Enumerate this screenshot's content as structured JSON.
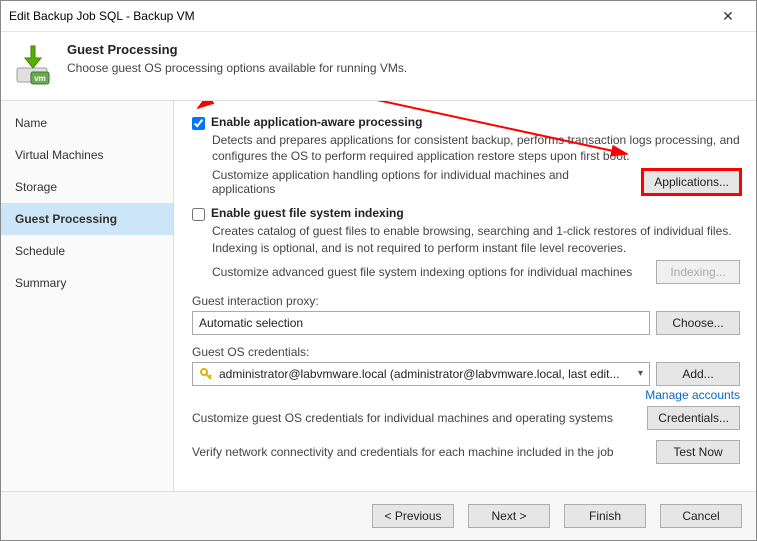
{
  "window": {
    "title": "Edit Backup Job SQL - Backup VM"
  },
  "header": {
    "icon_name": "guest-processing-icon",
    "title": "Guest Processing",
    "subtitle": "Choose guest OS processing options available for running VMs."
  },
  "sidebar": {
    "items": [
      "Name",
      "Virtual Machines",
      "Storage",
      "Guest Processing",
      "Schedule",
      "Summary"
    ],
    "selected_index": 3
  },
  "content": {
    "app_aware": {
      "checked": true,
      "title": "Enable application-aware processing",
      "desc": "Detects and prepares applications for consistent backup, performs transaction logs processing, and configures the OS to perform required application restore steps upon first boot.",
      "customize_label": "Customize application handling options for individual machines and applications",
      "button": "Applications...",
      "button_highlight": true
    },
    "indexing": {
      "checked": false,
      "title": "Enable guest file system indexing",
      "desc": "Creates catalog of guest files to enable browsing, searching and 1-click restores of individual files. Indexing is optional, and is not required to perform instant file level recoveries.",
      "customize_label": "Customize advanced guest file system indexing options for individual machines",
      "button": "Indexing...",
      "button_disabled": true
    },
    "proxy": {
      "label": "Guest interaction proxy:",
      "value": "Automatic selection",
      "button": "Choose..."
    },
    "creds": {
      "label": "Guest OS credentials:",
      "value": "administrator@labvmware.local (administrator@labvmware.local, last edit...",
      "button": "Add...",
      "manage_link": "Manage accounts"
    },
    "creds_customize": {
      "label": "Customize guest OS credentials for individual machines and operating systems",
      "button": "Credentials..."
    },
    "verify": {
      "label": "Verify network connectivity and credentials for each machine included in the job",
      "button": "Test Now"
    }
  },
  "footer": {
    "previous": "< Previous",
    "next": "Next >",
    "finish": "Finish",
    "cancel": "Cancel"
  }
}
